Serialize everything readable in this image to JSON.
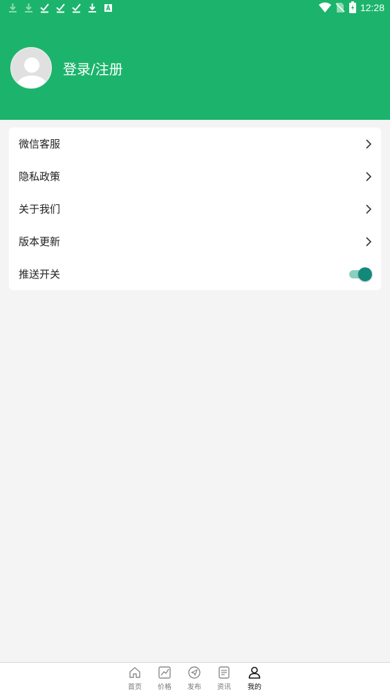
{
  "status_bar": {
    "time": "12:28",
    "left_icons": [
      "download-icon",
      "download-icon",
      "check-icon",
      "check-icon",
      "check-icon",
      "download-icon",
      "a-icon"
    ],
    "right_icons": [
      "wifi-icon",
      "no-sim-icon",
      "battery-icon"
    ]
  },
  "profile": {
    "login_label": "登录/注册"
  },
  "menu": {
    "items": [
      {
        "label": "微信客服"
      },
      {
        "label": "隐私政策"
      },
      {
        "label": "关于我们"
      },
      {
        "label": "版本更新"
      },
      {
        "label": "推送开关"
      }
    ],
    "push_enabled": true
  },
  "tabbar": {
    "tabs": [
      {
        "label": "首页"
      },
      {
        "label": "价格"
      },
      {
        "label": "发布"
      },
      {
        "label": "资讯"
      },
      {
        "label": "我的"
      }
    ],
    "active": "我的"
  },
  "colors": {
    "brand_green": "#1cb46c",
    "toggle_on": "#13897a"
  }
}
